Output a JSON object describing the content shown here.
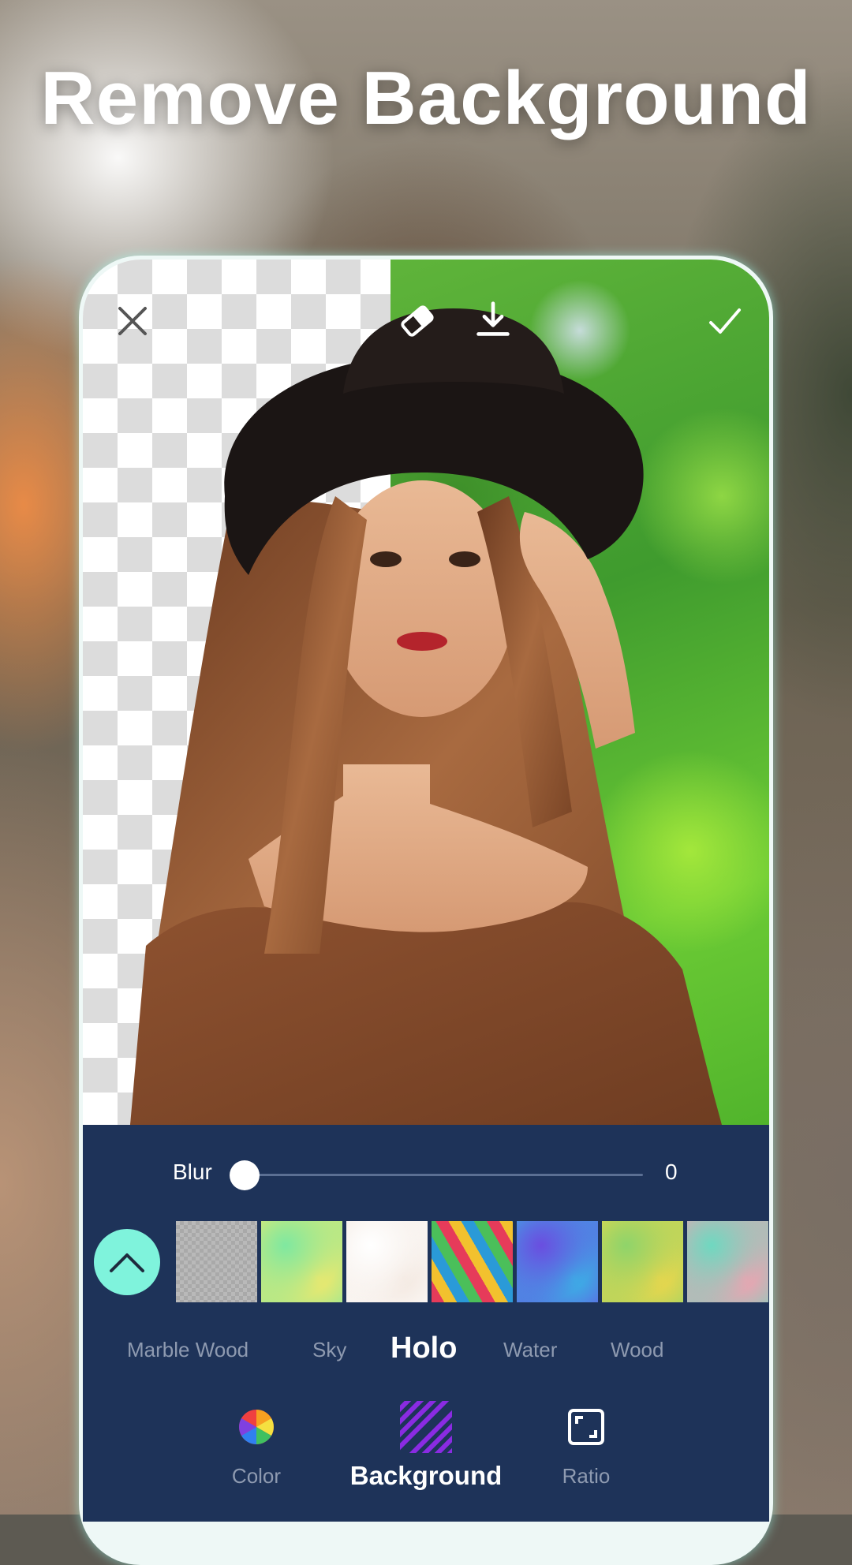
{
  "headline": "Remove Background",
  "toolbar": {
    "close_icon": "close-icon",
    "eraser_icon": "eraser-icon",
    "download_icon": "download-icon",
    "confirm_icon": "check-icon"
  },
  "blur": {
    "label": "Blur",
    "value": "0",
    "level": 0
  },
  "backgrounds": {
    "expand_icon": "chevron-up-icon",
    "thumbnails": [
      {
        "name": "transparent",
        "colors": [
          "#b9b9b9",
          "#a9a9a9"
        ]
      },
      {
        "name": "holo-1",
        "colors": [
          "#7fe8a0",
          "#f4e86a"
        ]
      },
      {
        "name": "holo-2",
        "colors": [
          "#ffffff",
          "#f3e8e0"
        ]
      },
      {
        "name": "holo-3",
        "colors": [
          "#e63b5a",
          "#2a9ad8"
        ]
      },
      {
        "name": "holo-4",
        "colors": [
          "#6a4ee0",
          "#38b6e6"
        ]
      },
      {
        "name": "holo-5",
        "colors": [
          "#8fd46a",
          "#f0d64a"
        ]
      },
      {
        "name": "holo-6",
        "colors": [
          "#6fd8c0",
          "#f4a0b0"
        ]
      }
    ]
  },
  "categories": [
    {
      "label": "Marble Wood",
      "active": false
    },
    {
      "label": "Sky",
      "active": false
    },
    {
      "label": "Holo",
      "active": true
    },
    {
      "label": "Water",
      "active": false
    },
    {
      "label": "Wood",
      "active": false
    }
  ],
  "tools": [
    {
      "label": "Color",
      "icon": "color-wheel-icon",
      "active": false
    },
    {
      "label": "Background",
      "icon": "background-pattern-icon",
      "active": true
    },
    {
      "label": "Ratio",
      "icon": "ratio-frame-icon",
      "active": false
    }
  ],
  "colors": {
    "panel": "#1e3359",
    "accent": "#7ff3dc",
    "active_pattern": "#8a2be2"
  }
}
